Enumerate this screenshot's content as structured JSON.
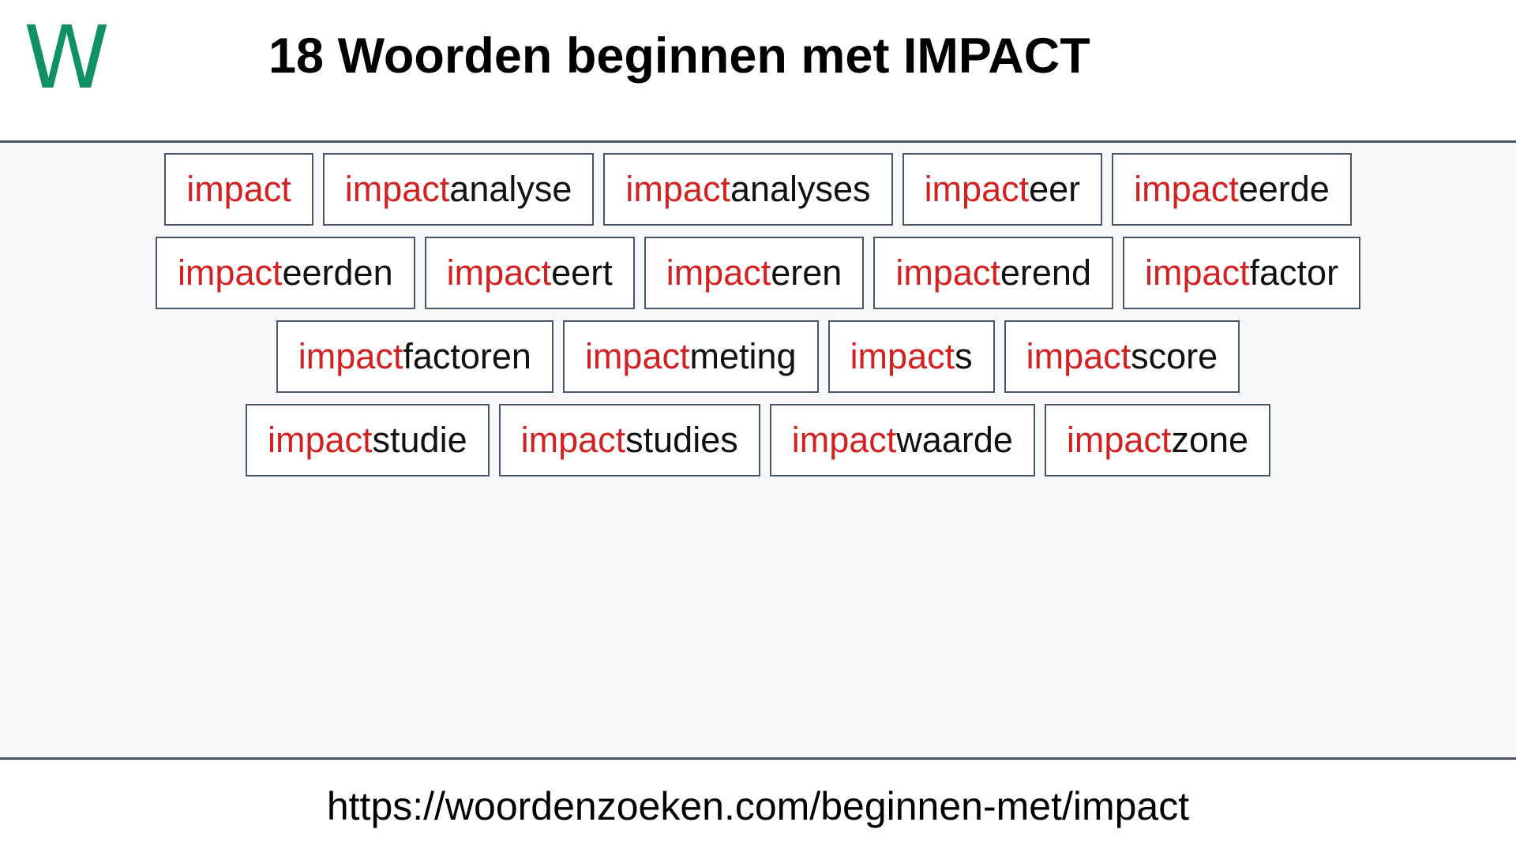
{
  "header": {
    "logo_text": "W",
    "logo_color": "#0f9168",
    "title": "18 Woorden beginnen met IMPACT"
  },
  "theme": {
    "prefix_color": "#d32020",
    "suffix_color": "#111111",
    "border_color": "#4a5568",
    "content_background": "#f6f8fa",
    "box_background": "#ffffff"
  },
  "content": {
    "word_count": 18,
    "highlight_prefix": "impact",
    "rows": [
      {
        "words": [
          {
            "prefix": "impact",
            "suffix": "",
            "full": "impact"
          },
          {
            "prefix": "impact",
            "suffix": "analyse",
            "full": "impactanalyse"
          },
          {
            "prefix": "impact",
            "suffix": "analyses",
            "full": "impactanalyses"
          },
          {
            "prefix": "impact",
            "suffix": "eer",
            "full": "impacteer"
          },
          {
            "prefix": "impact",
            "suffix": "eerde",
            "full": "impacteerde"
          }
        ]
      },
      {
        "words": [
          {
            "prefix": "impact",
            "suffix": "eerden",
            "full": "impacteerden"
          },
          {
            "prefix": "impact",
            "suffix": "eert",
            "full": "impacteert"
          },
          {
            "prefix": "impact",
            "suffix": "eren",
            "full": "impacteren"
          },
          {
            "prefix": "impact",
            "suffix": "erend",
            "full": "impacterend"
          },
          {
            "prefix": "impact",
            "suffix": "factor",
            "full": "impactfactor"
          }
        ]
      },
      {
        "words": [
          {
            "prefix": "impact",
            "suffix": "factoren",
            "full": "impactfactoren"
          },
          {
            "prefix": "impact",
            "suffix": "meting",
            "full": "impactmeting"
          },
          {
            "prefix": "impact",
            "suffix": "s",
            "full": "impacts"
          },
          {
            "prefix": "impact",
            "suffix": "score",
            "full": "impactscore"
          }
        ]
      },
      {
        "words": [
          {
            "prefix": "impact",
            "suffix": "studie",
            "full": "impactstudie"
          },
          {
            "prefix": "impact",
            "suffix": "studies",
            "full": "impactstudies"
          },
          {
            "prefix": "impact",
            "suffix": "waarde",
            "full": "impactwaarde"
          },
          {
            "prefix": "impact",
            "suffix": "zone",
            "full": "impactzone"
          }
        ]
      }
    ]
  },
  "footer": {
    "url": "https://woordenzoeken.com/beginnen-met/impact"
  }
}
